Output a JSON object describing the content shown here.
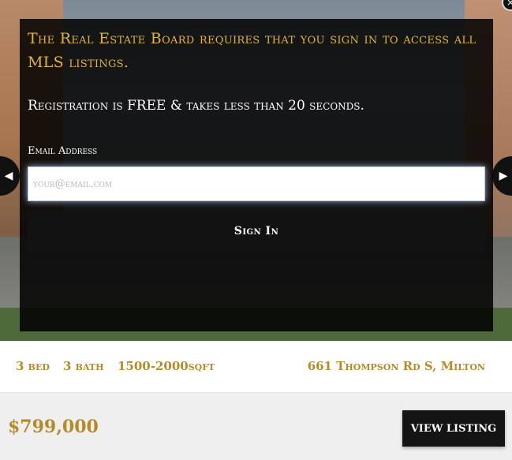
{
  "modal": {
    "headline": "The Real Estate Board requires that you sign in to access all MLS listings.",
    "subline": "Registration is FREE & takes less than 20 seconds.",
    "email_label": "Email Address",
    "email_placeholder": "your@email.com",
    "email_value": "",
    "signin_label": "Sign In",
    "close_glyph": "×"
  },
  "carousel": {
    "prev_glyph": "◀",
    "next_glyph": "▶"
  },
  "listing": {
    "beds": "3 bed",
    "baths": "3 bath",
    "sqft": "1500-2000sqft",
    "address": "661 Thompson Rd S, Milton",
    "price": "$799,000",
    "view_label": "VIEW LISTING"
  },
  "colors": {
    "accent_gold": "#b58a2a",
    "headline_gold": "#e3b33f",
    "overlay": "#000000"
  }
}
